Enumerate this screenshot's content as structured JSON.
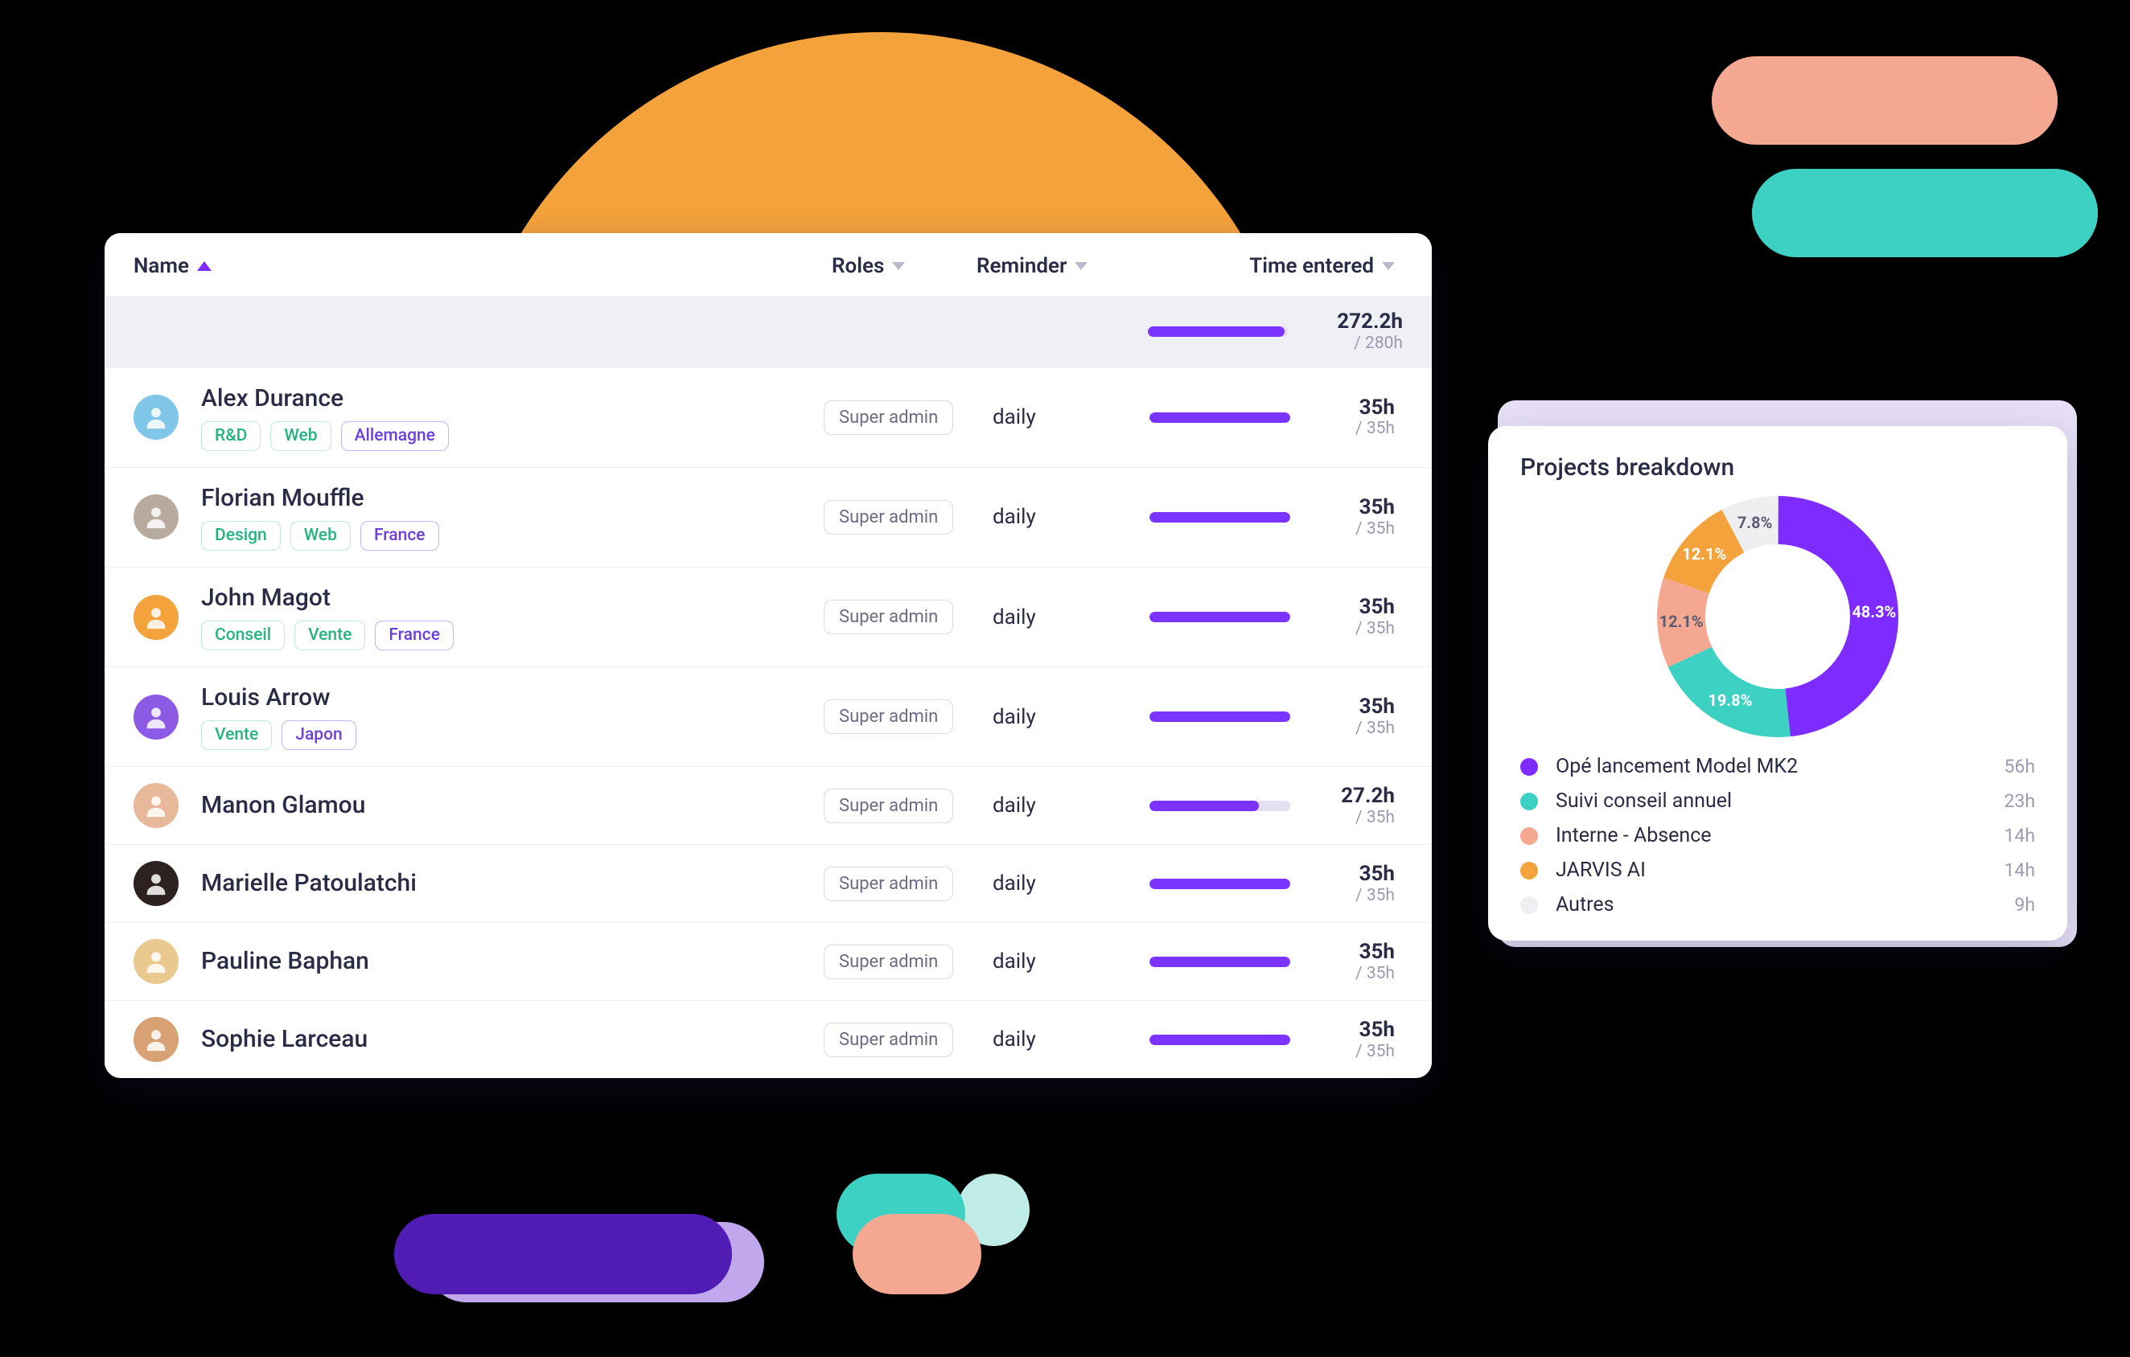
{
  "colors": {
    "violet": "#7d2bff",
    "teal": "#3dd1c4",
    "coral": "#f4a791",
    "orange": "#f4a23b",
    "offwhite": "#efeff2"
  },
  "table": {
    "headers": {
      "name": "Name",
      "roles": "Roles",
      "reminder": "Reminder",
      "time": "Time entered"
    },
    "summary": {
      "hours": "272.2h",
      "of": "/ 280h",
      "ratio": 0.972
    },
    "rows": [
      {
        "name": "Alex Durance",
        "avatar_bg": "#7fc6e8",
        "tags": [
          {
            "t": "R&D",
            "c": "g"
          },
          {
            "t": "Web",
            "c": "g"
          },
          {
            "t": "Allemagne",
            "c": "v"
          }
        ],
        "role": "Super admin",
        "reminder": "daily",
        "hours": "35h",
        "of": "/ 35h",
        "ratio": 1
      },
      {
        "name": "Florian Mouffle",
        "avatar_bg": "#b7aa9e",
        "tags": [
          {
            "t": "Design",
            "c": "g"
          },
          {
            "t": "Web",
            "c": "g"
          },
          {
            "t": "France",
            "c": "v"
          }
        ],
        "role": "Super admin",
        "reminder": "daily",
        "hours": "35h",
        "of": "/ 35h",
        "ratio": 1
      },
      {
        "name": "John Magot",
        "avatar_bg": "#f4a23b",
        "tags": [
          {
            "t": "Conseil",
            "c": "g"
          },
          {
            "t": "Vente",
            "c": "g"
          },
          {
            "t": "France",
            "c": "v"
          }
        ],
        "role": "Super admin",
        "reminder": "daily",
        "hours": "35h",
        "of": "/ 35h",
        "ratio": 1
      },
      {
        "name": "Louis Arrow",
        "avatar_bg": "#8d5ae6",
        "tags": [
          {
            "t": "Vente",
            "c": "g"
          },
          {
            "t": "Japon",
            "c": "v"
          }
        ],
        "role": "Super admin",
        "reminder": "daily",
        "hours": "35h",
        "of": "/ 35h",
        "ratio": 1
      },
      {
        "name": "Manon Glamou",
        "avatar_bg": "#e8b89a",
        "tags": [],
        "role": "Super admin",
        "reminder": "daily",
        "hours": "27.2h",
        "of": "/ 35h",
        "ratio": 0.777
      },
      {
        "name": "Marielle Patoulatchi",
        "avatar_bg": "#2d2220",
        "tags": [],
        "role": "Super admin",
        "reminder": "daily",
        "hours": "35h",
        "of": "/ 35h",
        "ratio": 1
      },
      {
        "name": "Pauline Baphan",
        "avatar_bg": "#e9c98e",
        "tags": [],
        "role": "Super admin",
        "reminder": "daily",
        "hours": "35h",
        "of": "/ 35h",
        "ratio": 1
      },
      {
        "name": "Sophie Larceau",
        "avatar_bg": "#d8a275",
        "tags": [],
        "role": "Super admin",
        "reminder": "daily",
        "hours": "35h",
        "of": "/ 35h",
        "ratio": 1
      }
    ]
  },
  "breakdown": {
    "title": "Projects breakdown",
    "items": [
      {
        "name": "Opé lancement Model MK2",
        "hours": "56h",
        "pct": 48.3,
        "color": "#7d2bff"
      },
      {
        "name": "Suivi conseil annuel",
        "hours": "23h",
        "pct": 19.8,
        "color": "#3dd1c4"
      },
      {
        "name": "Interne - Absence",
        "hours": "14h",
        "pct": 12.1,
        "color": "#f4a791"
      },
      {
        "name": "JARVIS AI",
        "hours": "14h",
        "pct": 12.1,
        "color": "#f4a23b"
      },
      {
        "name": "Autres",
        "hours": "9h",
        "pct": 7.8,
        "color": "#efeff2"
      }
    ]
  },
  "chart_data": {
    "type": "pie",
    "title": "Projects breakdown",
    "categories": [
      "Opé lancement Model MK2",
      "Suivi conseil annuel",
      "Interne - Absence",
      "JARVIS AI",
      "Autres"
    ],
    "values": [
      48.3,
      19.8,
      12.1,
      12.1,
      7.8
    ],
    "hours": [
      56,
      23,
      14,
      14,
      9
    ],
    "colors": [
      "#7d2bff",
      "#3dd1c4",
      "#f4a791",
      "#f4a23b",
      "#efeff2"
    ]
  }
}
